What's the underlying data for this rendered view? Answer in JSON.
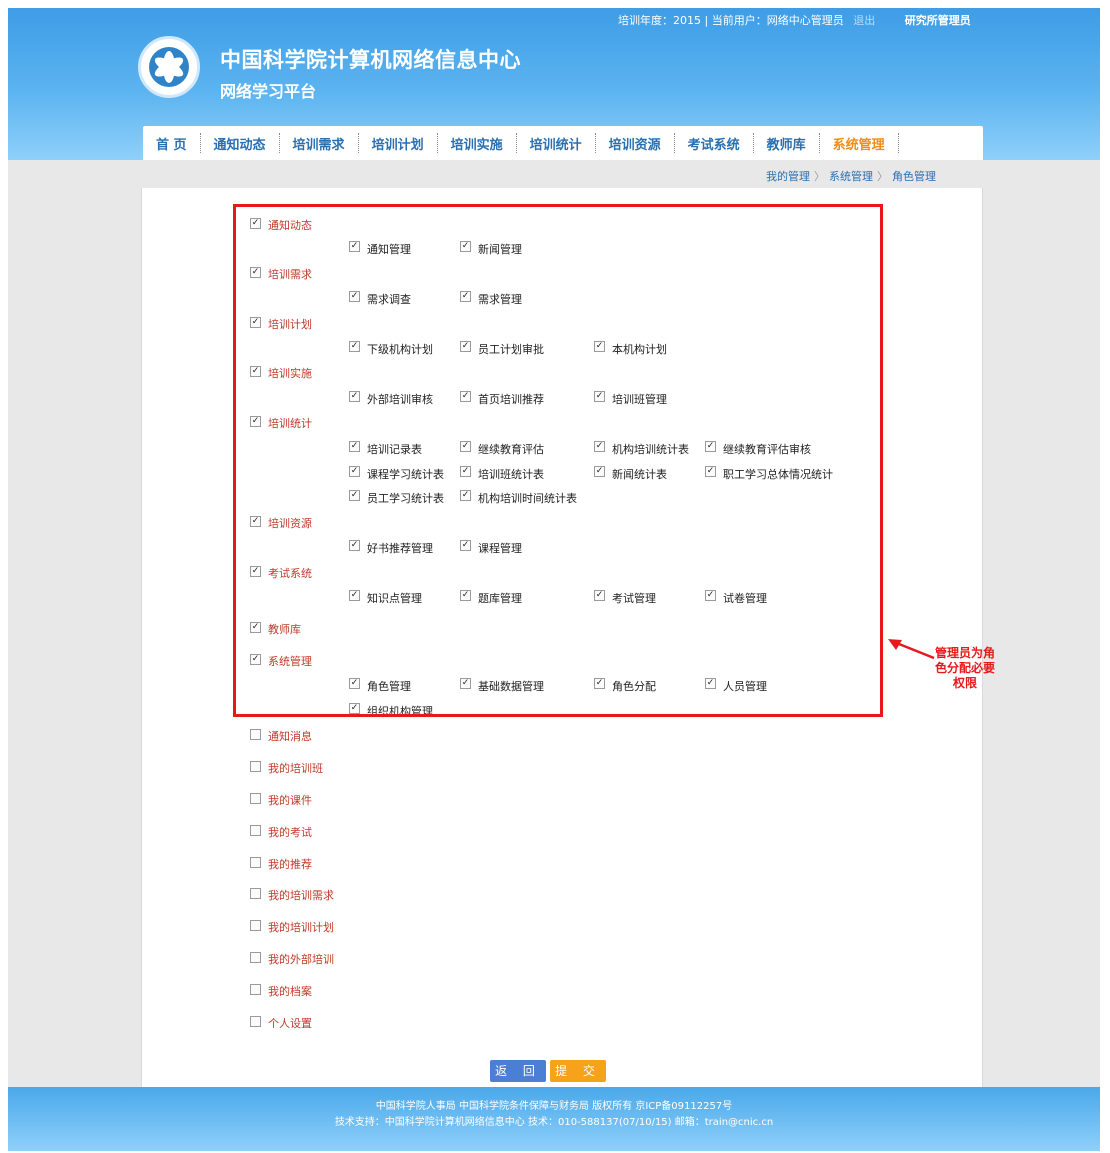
{
  "header": {
    "topbar": {
      "year_user": "培训年度：2015 | 当前用户：网络中心管理员",
      "logout": "退出",
      "role": "研究所管理员"
    },
    "title": "中国科学院计算机网络信息中心",
    "subtitle": "网络学习平台"
  },
  "nav": {
    "items": [
      "首 页",
      "通知动态",
      "培训需求",
      "培训计划",
      "培训实施",
      "培训统计",
      "培训资源",
      "考试系统",
      "教师库",
      "系统管理"
    ],
    "active": "系统管理"
  },
  "breadcrumb": [
    "我的管理",
    "系统管理",
    "角色管理"
  ],
  "permissions": {
    "g0": {
      "label": "通知动态",
      "children": [
        "通知管理",
        "新闻管理"
      ]
    },
    "g1": {
      "label": "培训需求",
      "children": [
        "需求调查",
        "需求管理"
      ]
    },
    "g2": {
      "label": "培训计划",
      "children": [
        "下级机构计划",
        "员工计划审批",
        "本机构计划"
      ]
    },
    "g3": {
      "label": "培训实施",
      "children": [
        "外部培训审核",
        "首页培训推荐",
        "培训班管理"
      ]
    },
    "g4": {
      "label": "培训统计",
      "children": [
        "培训记录表",
        "继续教育评估",
        "机构培训统计表",
        "继续教育评估审核",
        "课程学习统计表",
        "培训班统计表",
        "新闻统计表",
        "职工学习总体情况统计",
        "员工学习统计表",
        "机构培训时间统计表"
      ]
    },
    "g5": {
      "label": "培训资源",
      "children": [
        "好书推荐管理",
        "课程管理"
      ]
    },
    "g6": {
      "label": "考试系统",
      "children": [
        "知识点管理",
        "题库管理",
        "考试管理",
        "试卷管理"
      ]
    },
    "g7": {
      "label": "教师库",
      "children": []
    },
    "g8": {
      "label": "系统管理",
      "children": [
        "角色管理",
        "基础数据管理",
        "角色分配",
        "人员管理",
        "组织机构管理"
      ]
    },
    "unchecked": [
      "通知消息",
      "我的培训班",
      "我的课件",
      "我的考试",
      "我的推荐",
      "我的培训需求",
      "我的培训计划",
      "我的外部培训",
      "我的档案",
      "个人设置"
    ]
  },
  "annotation": "管理员为角色分配必要权限",
  "buttons": {
    "back": "返 回",
    "submit": "提 交"
  },
  "footer": {
    "line1": "中国科学院人事局 中国科学院条件保障与财务局 版权所有 京ICP备09112257号",
    "line2": "技术支持：中国科学院计算机网络信息中心 技术：010-588137(07/10/15) 邮箱：train@cnic.cn"
  },
  "colors": {
    "header_blue": "#3e9de6",
    "highlight_red": "#e8191c",
    "nav_active": "#f08c1a",
    "parent_label": "#c0392b"
  }
}
